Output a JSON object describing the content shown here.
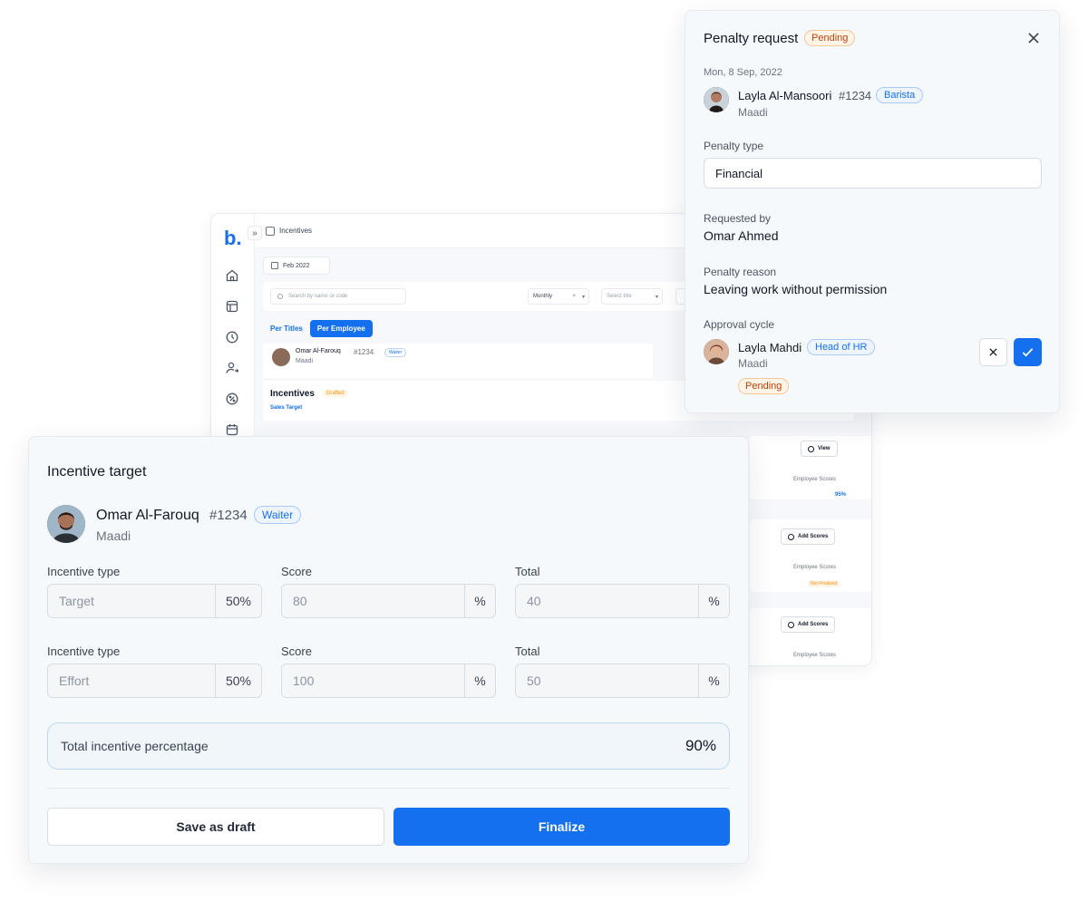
{
  "background_app": {
    "logo": "b.",
    "header_title": "Incentives",
    "date_filter": "Feb 2022",
    "search_placeholder": "Search by name or code",
    "period_select": "Monthly",
    "title_select_placeholder": "Select title",
    "tabs": [
      {
        "label": "Per Titles",
        "active": false
      },
      {
        "label": "Per Employee",
        "active": true
      }
    ],
    "employee": {
      "name": "Omar Al-Farouq",
      "id": "#1234",
      "role": "Waiter",
      "location": "Maadi"
    },
    "incentives_section": {
      "title": "Incentives",
      "badge": "Drafted",
      "subtitle": "Sales Target"
    },
    "view_button": "View",
    "add_scores_button": "Add Scores",
    "employee_scores_label": "Employee Scores",
    "score_value": "95%",
    "not_finalized_badge": "Not Finalized"
  },
  "penalty_request": {
    "title": "Penalty request",
    "status": "Pending",
    "date": "Mon, 8 Sep, 2022",
    "employee": {
      "name": "Layla Al-Mansoori",
      "id": "#1234",
      "role": "Barista",
      "location": "Maadi"
    },
    "penalty_type_label": "Penalty type",
    "penalty_type_value": "Financial",
    "requested_by_label": "Requested by",
    "requested_by_value": "Omar Ahmed",
    "reason_label": "Penalty reason",
    "reason_value": "Leaving work without permission",
    "approval_label": "Approval cycle",
    "approver": {
      "name": "Layla Mahdi",
      "role": "Head of HR",
      "location": "Maadi",
      "status": "Pending"
    }
  },
  "incentive_target": {
    "title": "Incentive target",
    "employee": {
      "name": "Omar Al-Farouq",
      "id": "#1234",
      "role": "Waiter",
      "location": "Maadi"
    },
    "rows": [
      {
        "type_label": "Incentive type",
        "type_value": "Target",
        "type_weight": "50%",
        "score_label": "Score",
        "score_value": "80",
        "score_unit": "%",
        "total_label": "Total",
        "total_value": "40",
        "total_unit": "%"
      },
      {
        "type_label": "Incentive type",
        "type_value": "Effort",
        "type_weight": "50%",
        "score_label": "Score",
        "score_value": "100",
        "score_unit": "%",
        "total_label": "Total",
        "total_value": "50",
        "total_unit": "%"
      }
    ],
    "total_label": "Total incentive percentage",
    "total_value": "90%",
    "save_draft_button": "Save as draft",
    "finalize_button": "Finalize"
  },
  "colors": {
    "accent": "#1570ef",
    "pending": "#c2410c",
    "card_bg": "#f6f9fc"
  }
}
